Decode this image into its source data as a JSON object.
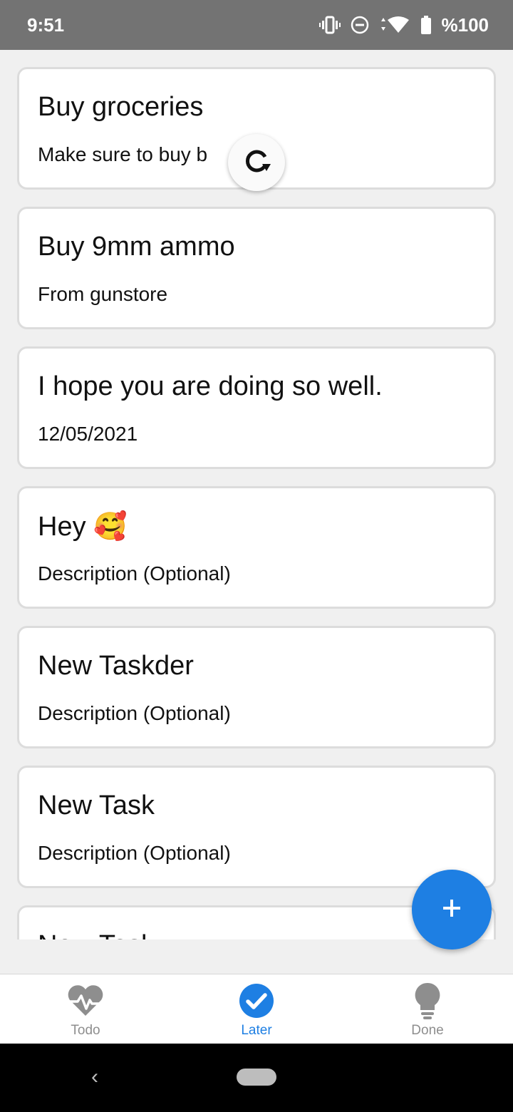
{
  "status_bar": {
    "time": "9:51",
    "battery": "%100",
    "icons": [
      "vibrate-icon",
      "do-not-disturb-icon",
      "data-arrows-icon",
      "wifi-icon",
      "battery-icon"
    ]
  },
  "tasks": [
    {
      "title": "Buy groceries",
      "description": "Make sure to buy b"
    },
    {
      "title": "Buy 9mm ammo",
      "description": "From gunstore"
    },
    {
      "title": "I hope you are doing so well.",
      "description": "12/05/2021"
    },
    {
      "title": "Hey 🥰",
      "description": "Description (Optional)"
    },
    {
      "title": "New Taskder",
      "description": "Description (Optional)"
    },
    {
      "title": "New Task",
      "description": "Description (Optional)"
    },
    {
      "title": "New Task",
      "description": ""
    }
  ],
  "fab": {
    "icon": "plus-icon",
    "color": "#1e7fe3"
  },
  "refresh": {
    "icon": "refresh-icon"
  },
  "tabs": [
    {
      "label": "Todo",
      "icon": "heart-pulse-icon",
      "active": false
    },
    {
      "label": "Later",
      "icon": "check-circle-icon",
      "active": true
    },
    {
      "label": "Done",
      "icon": "lightbulb-icon",
      "active": false
    }
  ],
  "colors": {
    "accent": "#1e7fe3",
    "status_bar": "#737373",
    "inactive_tab": "#8e8e8e"
  }
}
